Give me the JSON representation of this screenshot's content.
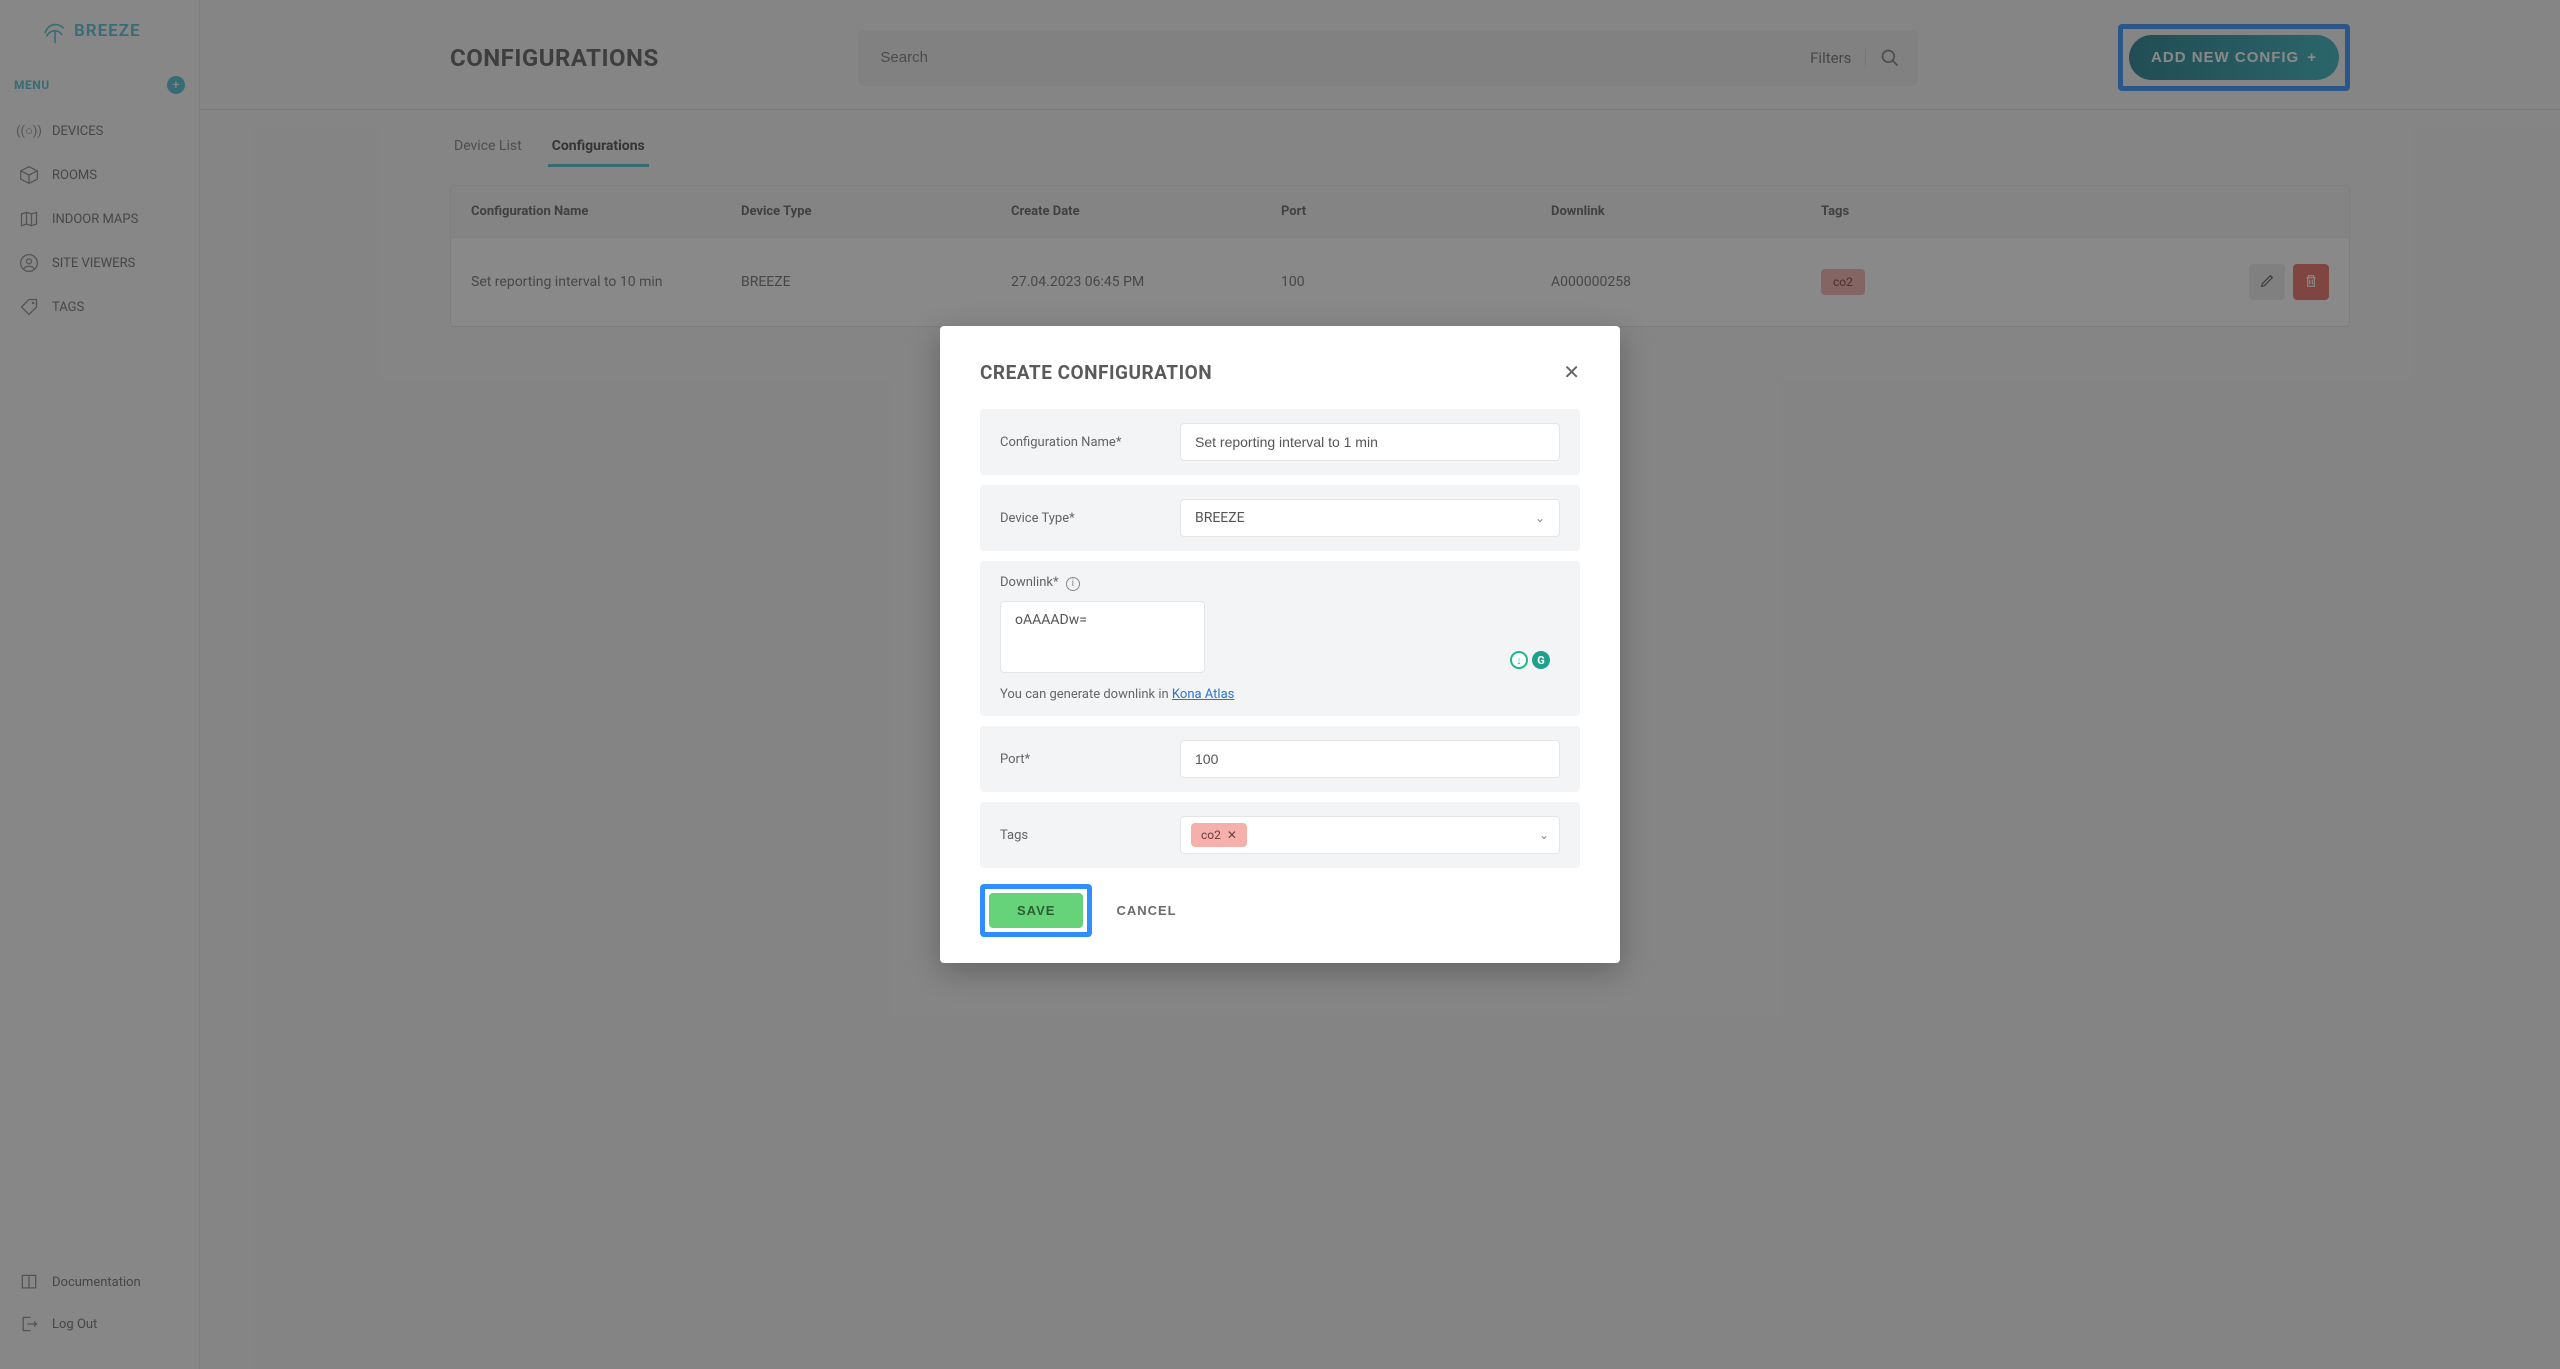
{
  "brand": {
    "name": "BREEZE"
  },
  "sidebar": {
    "menu_label": "MENU",
    "items": [
      {
        "label": "DEVICES"
      },
      {
        "label": "ROOMS"
      },
      {
        "label": "INDOOR MAPS"
      },
      {
        "label": "SITE VIEWERS"
      },
      {
        "label": "TAGS"
      }
    ],
    "bottom": [
      {
        "label": "Documentation"
      },
      {
        "label": "Log Out"
      }
    ]
  },
  "header": {
    "title": "CONFIGURATIONS",
    "search_placeholder": "Search",
    "filters_label": "Filters",
    "add_config_label": "ADD NEW CONFIG"
  },
  "tabs": [
    {
      "label": "Device List",
      "active": false
    },
    {
      "label": "Configurations",
      "active": true
    }
  ],
  "table": {
    "columns": [
      "Configuration Name",
      "Device Type",
      "Create Date",
      "Port",
      "Downlink",
      "Tags"
    ],
    "rows": [
      {
        "name": "Set reporting interval to 10 min",
        "device_type": "BREEZE",
        "create_date": "27.04.2023 06:45 PM",
        "port": "100",
        "downlink": "A000000258",
        "tags": [
          "co2"
        ]
      }
    ]
  },
  "modal": {
    "title": "CREATE CONFIGURATION",
    "fields": {
      "config_name": {
        "label": "Configuration Name*",
        "value": "Set reporting interval to 1 min"
      },
      "device_type": {
        "label": "Device Type*",
        "value": "BREEZE"
      },
      "downlink": {
        "label": "Downlink*",
        "value": "oAAAADw="
      },
      "downlink_hint_prefix": "You can generate downlink in ",
      "downlink_hint_link": "Kona Atlas",
      "port": {
        "label": "Port*",
        "value": "100"
      },
      "tags": {
        "label": "Tags",
        "values": [
          "co2"
        ]
      }
    },
    "save_label": "SAVE",
    "cancel_label": "CANCEL"
  }
}
